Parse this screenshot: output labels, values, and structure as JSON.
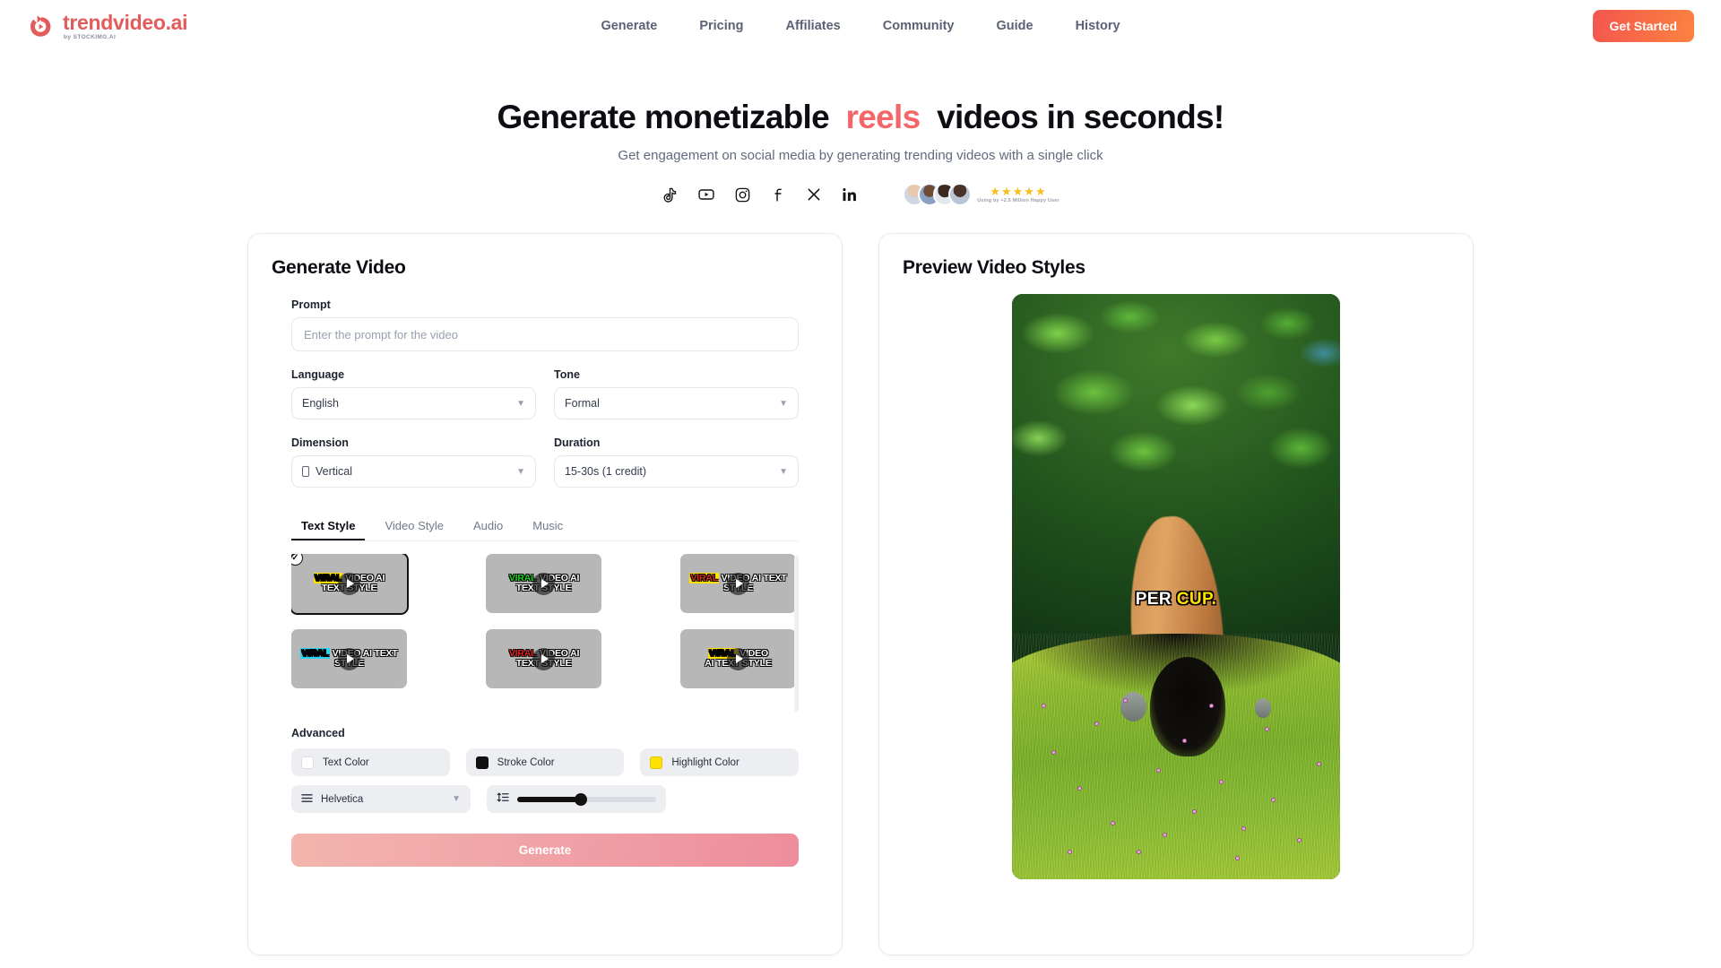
{
  "header": {
    "logo": {
      "name": "trendvideo.ai",
      "sub": "by STOCKIMG.AI"
    },
    "nav": [
      {
        "label": "Generate"
      },
      {
        "label": "Pricing"
      },
      {
        "label": "Affiliates"
      },
      {
        "label": "Community"
      },
      {
        "label": "Guide"
      },
      {
        "label": "History"
      }
    ],
    "cta_label": "Get Started"
  },
  "hero": {
    "title_part1": "Generate monetizable",
    "title_accent": "reels",
    "title_part2": "videos in seconds!",
    "subtitle": "Get engagement on social media by generating trending videos with a single click",
    "social": [
      {
        "name": "tiktok-icon"
      },
      {
        "name": "youtube-icon"
      },
      {
        "name": "instagram-icon"
      },
      {
        "name": "facebook-icon"
      },
      {
        "name": "x-icon"
      },
      {
        "name": "linkedin-icon"
      }
    ],
    "rating": {
      "stars": "★★★★★",
      "caption": "Using by +2.5 Million Happy User"
    }
  },
  "generate_panel": {
    "title": "Generate Video",
    "prompt": {
      "label": "Prompt",
      "placeholder": "Enter the prompt for the video",
      "value": ""
    },
    "language": {
      "label": "Language",
      "value": "English"
    },
    "tone": {
      "label": "Tone",
      "value": "Formal"
    },
    "dimension": {
      "label": "Dimension",
      "value": "Vertical"
    },
    "duration": {
      "label": "Duration",
      "value": "15-30s (1 credit)"
    },
    "tabs": [
      {
        "label": "Text Style",
        "active": true
      },
      {
        "label": "Video Style",
        "active": false
      },
      {
        "label": "Audio",
        "active": false
      },
      {
        "label": "Music",
        "active": false
      }
    ],
    "text_styles": [
      {
        "line1_hl": "VIRAL",
        "line1_rest": "VIDEO AI",
        "line2": "TEXT STYLE",
        "hl_color": "#ffe100",
        "hl_text": "#000000",
        "rest_color": "#ffffff",
        "selected": true
      },
      {
        "line1_hl": "VIRAL",
        "line1_rest": "VIDEO AI",
        "line2": "TEXT STYLE",
        "hl_color": "transparent",
        "hl_text": "#19d419",
        "rest_color": "#ffffff",
        "selected": false
      },
      {
        "line1_hl": "VIRAL",
        "line1_rest": "VIDEO AI TEXT",
        "line2": "STYLE",
        "hl_color": "#ffe100",
        "hl_text": "#d92b1c",
        "rest_color": "#ffffff",
        "selected": false
      },
      {
        "line1_hl": "VIRAL",
        "line1_rest": "VIDEO AI TEXT",
        "line2": "STYLE",
        "hl_color": "#2ad4ee",
        "hl_text": "#000000",
        "rest_color": "#ffffff",
        "selected": false
      },
      {
        "line1_hl": "VIRAL",
        "line1_rest": "VIDEO AI",
        "line2": "TEXT STYLE",
        "hl_color": "transparent",
        "hl_text": "#e81c1c",
        "rest_color": "#ffffff",
        "selected": false
      },
      {
        "line1_hl": "VIRAL",
        "line1_rest": "VIDEO",
        "line2": "AI TEXT STYLE",
        "hl_color": "#ffe100",
        "hl_text": "#000000",
        "rest_color": "#ffffff",
        "selected": false
      }
    ],
    "advanced": {
      "title": "Advanced",
      "text_color": {
        "label": "Text Color",
        "value": "#ffffff"
      },
      "stroke_color": {
        "label": "Stroke Color",
        "value": "#111111"
      },
      "highlight_color": {
        "label": "Highlight Color",
        "value": "#ffe100"
      },
      "font": {
        "label": "Helvetica"
      },
      "line_spacing": {
        "value": 46
      }
    },
    "generate_button": "Generate"
  },
  "preview_panel": {
    "title": "Preview Video Styles",
    "caption_white": "PER",
    "caption_yellow": "CUP."
  }
}
